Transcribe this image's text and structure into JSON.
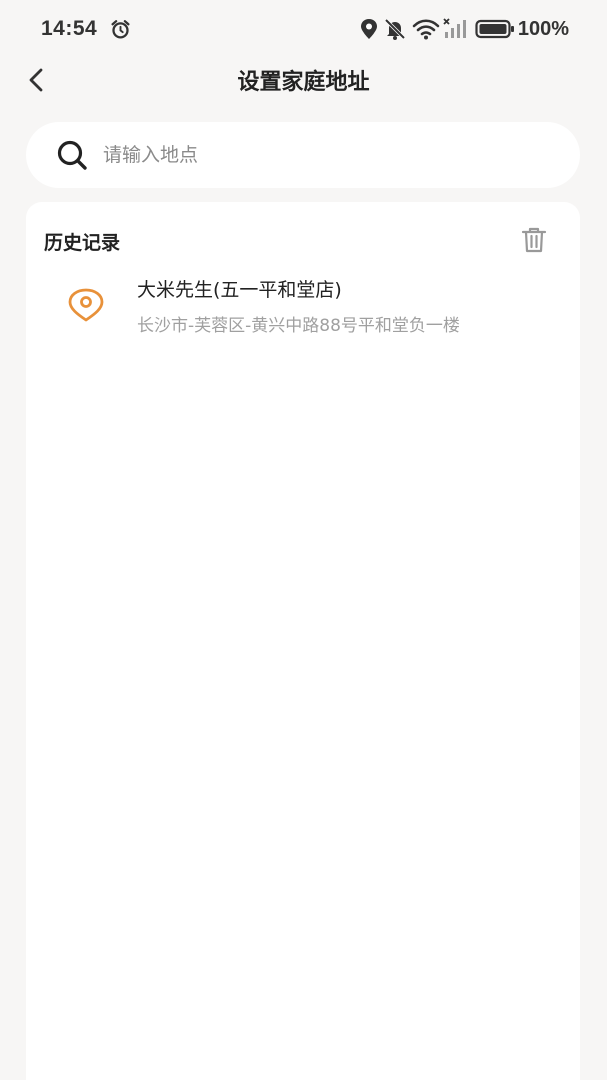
{
  "status_bar": {
    "time": "14:54",
    "battery": "100%",
    "icons": [
      "alarm-icon",
      "location-icon",
      "mute-icon",
      "wifi-icon",
      "signal-icon",
      "battery-icon"
    ]
  },
  "header": {
    "title": "设置家庭地址",
    "back_icon": "chevron-left-icon"
  },
  "search": {
    "placeholder": "请输入地点",
    "value": "",
    "icon": "search-icon"
  },
  "history": {
    "title": "历史记录",
    "clear_icon": "trash-icon",
    "items": [
      {
        "name": "大米先生(五一平和堂店)",
        "address": "长沙市-芙蓉区-黄兴中路88号平和堂负一楼",
        "icon": "location-pin-icon"
      }
    ]
  },
  "colors": {
    "background": "#f7f6f5",
    "card": "#ffffff",
    "accent": "#e8913a",
    "secondary_text": "#a0a0a0"
  }
}
